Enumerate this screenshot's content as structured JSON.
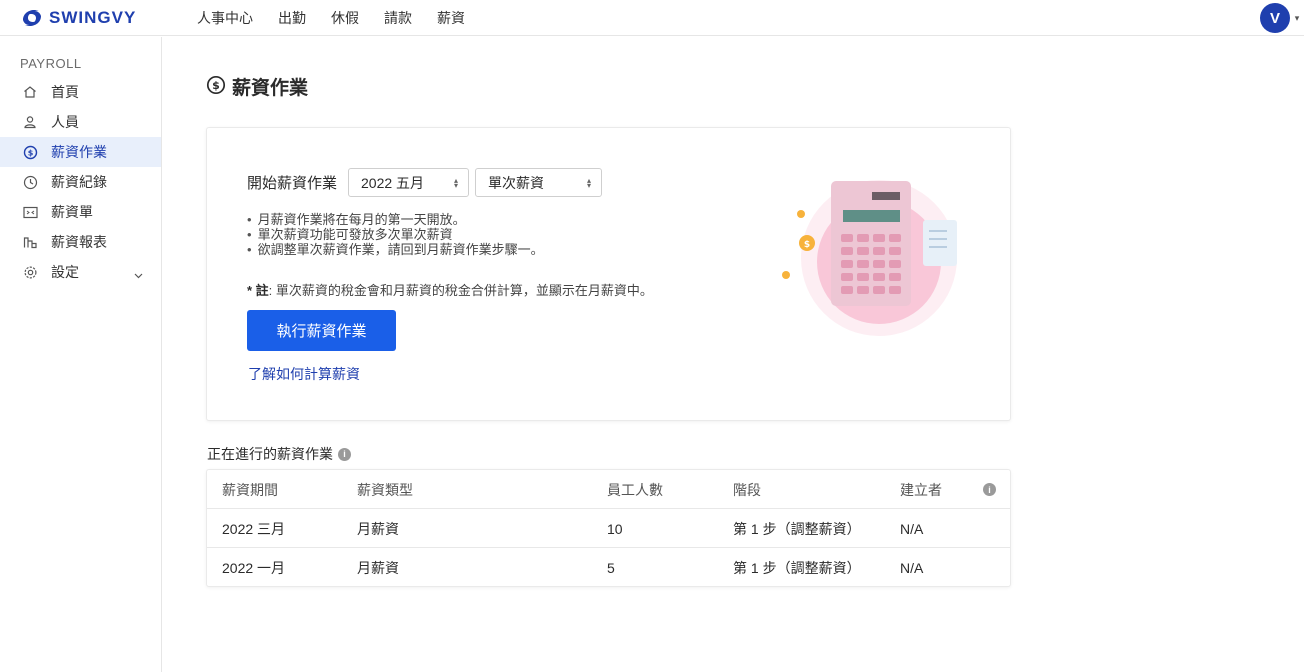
{
  "brand": {
    "name": "SWINGVY",
    "accent": "#1f3fae",
    "primary_button": "#1a5fe8"
  },
  "topnav": [
    "人事中心",
    "出勤",
    "休假",
    "請款",
    "薪資"
  ],
  "user": {
    "initial": "V"
  },
  "sidebar": {
    "heading": "PAYROLL",
    "items": [
      {
        "label": "首頁",
        "icon": "home-icon"
      },
      {
        "label": "人員",
        "icon": "person-icon"
      },
      {
        "label": "薪資作業",
        "icon": "payroll-run-icon",
        "active": true
      },
      {
        "label": "薪資紀錄",
        "icon": "history-icon"
      },
      {
        "label": "薪資單",
        "icon": "payslip-icon"
      },
      {
        "label": "薪資報表",
        "icon": "report-icon"
      },
      {
        "label": "設定",
        "icon": "gear-icon",
        "expandable": true
      }
    ]
  },
  "page": {
    "title": "薪資作業"
  },
  "start_card": {
    "label": "開始薪資作業",
    "period_select": "2022 五月",
    "type_select": "單次薪資",
    "bullets": [
      "月薪資作業將在每月的第一天開放。",
      "單次薪資功能可發放多次單次薪資",
      "欲調整單次薪資作業，請回到月薪資作業步驟一。"
    ],
    "note_prefix": "* 註",
    "note_text": ": 單次薪資的稅金會和月薪資的稅金合併計算，並顯示在月薪資中。",
    "run_button": "執行薪資作業",
    "learn_link": "了解如何計算薪資"
  },
  "in_progress": {
    "title": "正在進行的薪資作業",
    "columns": [
      "薪資期間",
      "薪資類型",
      "員工人數",
      "階段",
      "建立者"
    ],
    "rows": [
      [
        "2022 三月",
        "月薪資",
        "10",
        "第 1 步（調整薪資）",
        "N/A"
      ],
      [
        "2022 一月",
        "月薪資",
        "5",
        "第 1 步（調整薪資）",
        "N/A"
      ]
    ]
  }
}
